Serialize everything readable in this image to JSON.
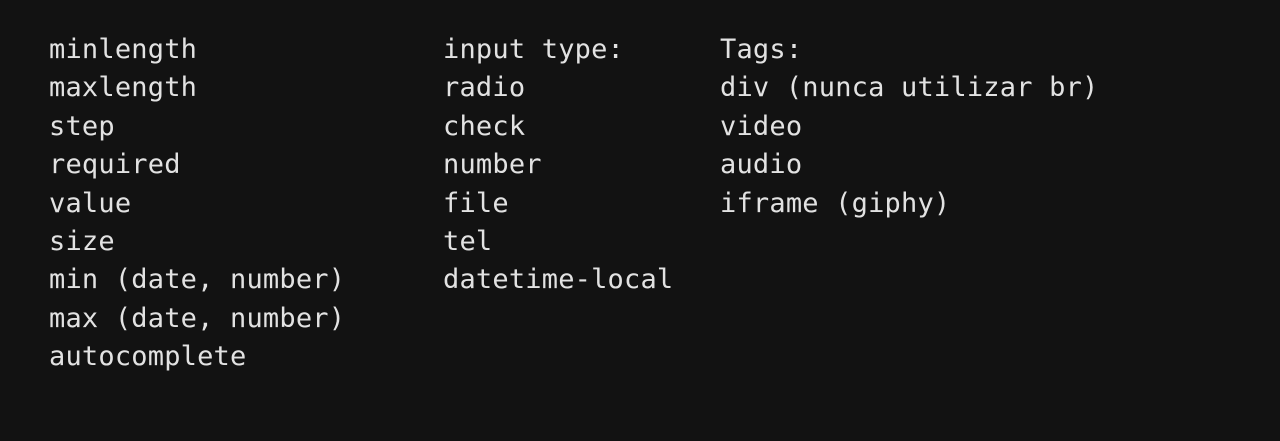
{
  "columns": {
    "attributes": [
      "minlength",
      "maxlength",
      "step",
      "required",
      "value",
      "size",
      "min (date, number)",
      "max (date, number)",
      "autocomplete"
    ],
    "input_types": [
      "input type:",
      "radio",
      "check",
      "number",
      "file",
      "tel",
      "datetime-local"
    ],
    "tags": [
      "Tags:",
      "div (nunca utilizar br)",
      "video",
      "audio",
      "iframe (giphy)"
    ]
  },
  "colors": {
    "background": "#121212",
    "text": "#e2e2e2"
  }
}
